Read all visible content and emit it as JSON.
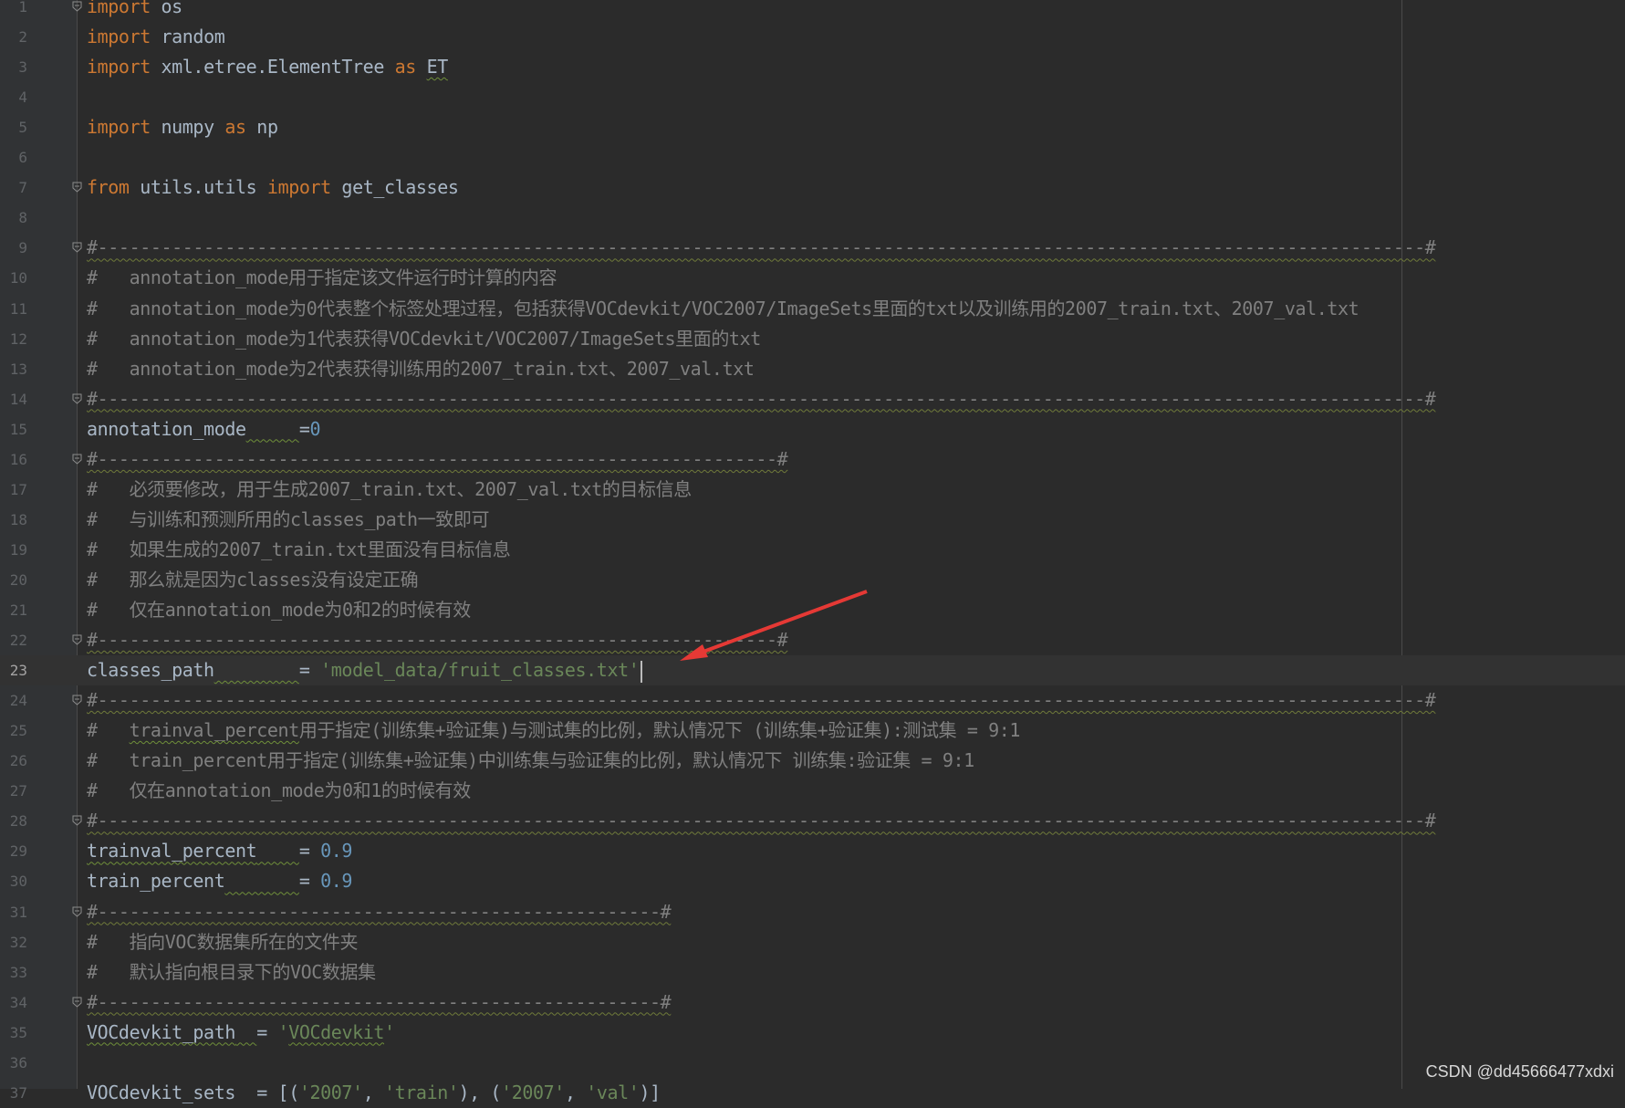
{
  "editor": {
    "current_line": 23,
    "colors": {
      "background": "#2b2b2b",
      "keyword": "#cc7832",
      "string": "#6a8759",
      "number": "#6897bb",
      "comment": "#808080",
      "text": "#a9b7c6",
      "annotation_arrow": "#e53935"
    },
    "lines": [
      {
        "n": "1",
        "fold": true,
        "tokens": [
          {
            "t": "import",
            "c": "kw"
          },
          {
            "t": " os"
          }
        ]
      },
      {
        "n": "2",
        "tokens": [
          {
            "t": "import",
            "c": "kw"
          },
          {
            "t": " random"
          }
        ]
      },
      {
        "n": "3",
        "tokens": [
          {
            "t": "import",
            "c": "kw"
          },
          {
            "t": " xml.etree.ElementTree "
          },
          {
            "t": "as",
            "c": "kw"
          },
          {
            "t": " "
          },
          {
            "t": "ET",
            "c": "squig"
          }
        ]
      },
      {
        "n": "4",
        "tokens": []
      },
      {
        "n": "5",
        "tokens": [
          {
            "t": "import",
            "c": "kw"
          },
          {
            "t": " numpy "
          },
          {
            "t": "as",
            "c": "kw"
          },
          {
            "t": " np"
          }
        ]
      },
      {
        "n": "6",
        "tokens": []
      },
      {
        "n": "7",
        "fold": true,
        "tokens": [
          {
            "t": "from",
            "c": "kw"
          },
          {
            "t": " utils.utils "
          },
          {
            "t": "import",
            "c": "kw"
          },
          {
            "t": " get_classes"
          }
        ]
      },
      {
        "n": "8",
        "tokens": []
      },
      {
        "n": "9",
        "fold": true,
        "tokens": [
          {
            "t": "#-----------------------------------------------------------------------------------------------------------------------------#",
            "c": "sep-line"
          }
        ]
      },
      {
        "n": "10",
        "tokens": [
          {
            "t": "#   annotation_mode用于指定该文件运行时计算的内容",
            "c": "cm"
          }
        ]
      },
      {
        "n": "11",
        "tokens": [
          {
            "t": "#   annotation_mode为0代表整个标签处理过程，包括获得VOCdevkit/VOC2007/ImageSets里面的txt以及训练用的2007_train.txt、2007_val.txt",
            "c": "cm"
          }
        ]
      },
      {
        "n": "12",
        "tokens": [
          {
            "t": "#   annotation_mode为1代表获得VOCdevkit/VOC2007/ImageSets里面的txt",
            "c": "cm"
          }
        ]
      },
      {
        "n": "13",
        "tokens": [
          {
            "t": "#   annotation_mode为2代表获得训练用的2007_train.txt、2007_val.txt",
            "c": "cm"
          }
        ]
      },
      {
        "n": "14",
        "fold": true,
        "tokens": [
          {
            "t": "#-----------------------------------------------------------------------------------------------------------------------------#",
            "c": "sep-line"
          }
        ]
      },
      {
        "n": "15",
        "tokens": [
          {
            "t": "annotation_mode"
          },
          {
            "t": "     ",
            "c": "sp-squig"
          },
          {
            "t": "="
          },
          {
            "t": "0",
            "c": "num"
          }
        ]
      },
      {
        "n": "16",
        "fold": true,
        "tokens": [
          {
            "t": "#----------------------------------------------------------------#",
            "c": "sep-line"
          }
        ]
      },
      {
        "n": "17",
        "tokens": [
          {
            "t": "#   必须要修改，用于生成2007_train.txt、2007_val.txt的目标信息",
            "c": "cm"
          }
        ]
      },
      {
        "n": "18",
        "tokens": [
          {
            "t": "#   与训练和预测所用的classes_path一致即可",
            "c": "cm"
          }
        ]
      },
      {
        "n": "19",
        "tokens": [
          {
            "t": "#   如果生成的2007_train.txt里面没有目标信息",
            "c": "cm"
          }
        ]
      },
      {
        "n": "20",
        "tokens": [
          {
            "t": "#   那么就是因为classes没有设定正确",
            "c": "cm"
          }
        ]
      },
      {
        "n": "21",
        "tokens": [
          {
            "t": "#   仅在annotation_mode为0和2的时候有效",
            "c": "cm"
          }
        ]
      },
      {
        "n": "22",
        "fold": true,
        "tokens": [
          {
            "t": "#----------------------------------------------------------------#",
            "c": "sep-line"
          }
        ]
      },
      {
        "n": "23",
        "caret": true,
        "tokens": [
          {
            "t": "classes_path"
          },
          {
            "t": "        ",
            "c": "sp-squig"
          },
          {
            "t": "= "
          },
          {
            "t": "'model_data/fruit_classes.txt'",
            "c": "str"
          }
        ]
      },
      {
        "n": "24",
        "fold": true,
        "tokens": [
          {
            "t": "#-----------------------------------------------------------------------------------------------------------------------------#",
            "c": "sep-line"
          }
        ]
      },
      {
        "n": "25",
        "tokens": [
          {
            "t": "#   ",
            "c": "cm"
          },
          {
            "t": "trainval_percent",
            "c": "cm squig"
          },
          {
            "t": "用于指定(训练集+验证集)与测试集的比例，默认情况下 (训练集+验证集):测试集 = 9:1",
            "c": "cm"
          }
        ]
      },
      {
        "n": "26",
        "tokens": [
          {
            "t": "#   train_percent用于指定(训练集+验证集)中训练集与验证集的比例，默认情况下 训练集:验证集 = 9:1",
            "c": "cm"
          }
        ]
      },
      {
        "n": "27",
        "tokens": [
          {
            "t": "#   仅在annotation_mode为0和1的时候有效",
            "c": "cm"
          }
        ]
      },
      {
        "n": "28",
        "fold": true,
        "tokens": [
          {
            "t": "#-----------------------------------------------------------------------------------------------------------------------------#",
            "c": "sep-line"
          }
        ]
      },
      {
        "n": "29",
        "tokens": [
          {
            "t": "trainval_percent",
            "c": "squig"
          },
          {
            "t": "    ",
            "c": "sp-squig"
          },
          {
            "t": "= "
          },
          {
            "t": "0.9",
            "c": "num"
          }
        ]
      },
      {
        "n": "30",
        "tokens": [
          {
            "t": "train_percent"
          },
          {
            "t": "       ",
            "c": "sp-squig"
          },
          {
            "t": "= "
          },
          {
            "t": "0.9",
            "c": "num"
          }
        ]
      },
      {
        "n": "31",
        "fold": true,
        "tokens": [
          {
            "t": "#-----------------------------------------------------#",
            "c": "sep-line"
          }
        ]
      },
      {
        "n": "32",
        "tokens": [
          {
            "t": "#   指向VOC数据集所在的文件夹",
            "c": "cm"
          }
        ]
      },
      {
        "n": "33",
        "tokens": [
          {
            "t": "#   默认指向根目录下的VOC数据集",
            "c": "cm"
          }
        ]
      },
      {
        "n": "34",
        "fold": true,
        "tokens": [
          {
            "t": "#-----------------------------------------------------#",
            "c": "sep-line"
          }
        ]
      },
      {
        "n": "35",
        "tokens": [
          {
            "t": "VOCdevkit_path",
            "c": "squig"
          },
          {
            "t": "  ",
            "c": "sp-squig"
          },
          {
            "t": "= "
          },
          {
            "t": "'",
            "c": "str"
          },
          {
            "t": "VOCdevkit",
            "c": "str squig"
          },
          {
            "t": "'",
            "c": "str"
          }
        ]
      },
      {
        "n": "36",
        "tokens": []
      },
      {
        "n": "37",
        "tokens": [
          {
            "t": "VOCdevkit_sets"
          },
          {
            "t": "  = [("
          },
          {
            "t": "'2007'",
            "c": "str"
          },
          {
            "t": ", "
          },
          {
            "t": "'train'",
            "c": "str"
          },
          {
            "t": "), ("
          },
          {
            "t": "'2007'",
            "c": "str"
          },
          {
            "t": ", "
          },
          {
            "t": "'val'",
            "c": "str"
          },
          {
            "t": ")]"
          }
        ]
      }
    ]
  },
  "watermark": "CSDN @dd45666477xdxi"
}
